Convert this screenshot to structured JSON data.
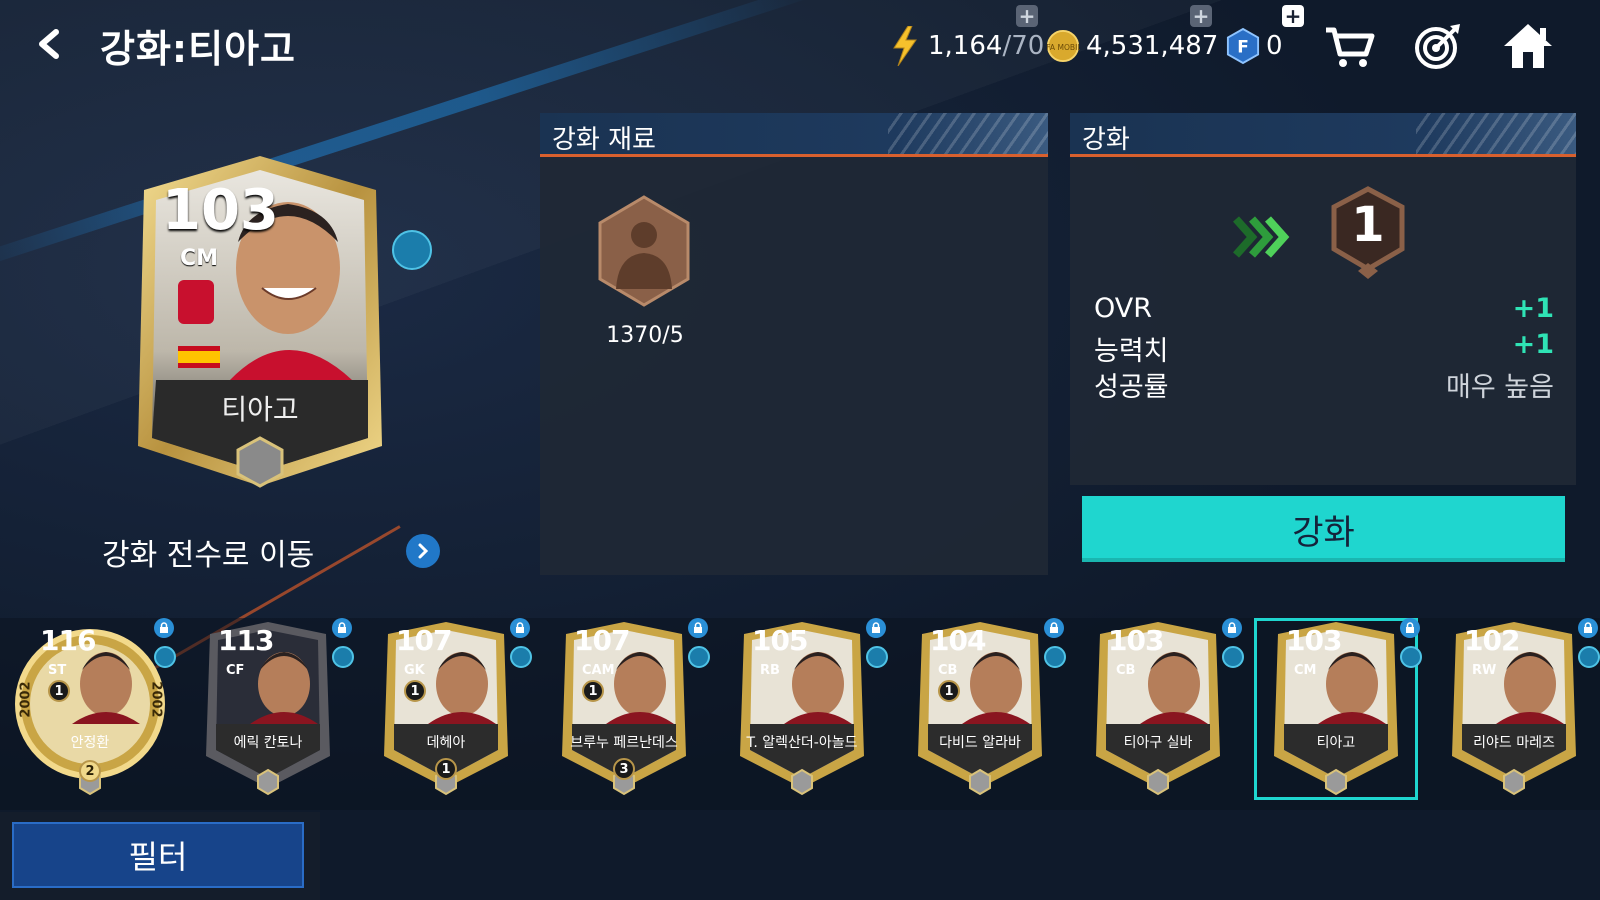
{
  "header": {
    "title": "강화:티아고",
    "energy": "1,164",
    "energy_max": "/70",
    "coins": "4,531,487",
    "fc_points": "0",
    "plus": "+",
    "coin_logo": "FIFA MOBILE",
    "fc_letter": "F"
  },
  "main_card": {
    "ovr": "103",
    "position": "CM",
    "name": "티아고",
    "club_color": "#c8102e",
    "nation": "spain-flag"
  },
  "move_label": "강화 전수로 이동",
  "material_panel": {
    "title": "강화 재료",
    "count": "1370/5"
  },
  "enhance_panel": {
    "title": "강화",
    "target_level": "1",
    "stats": [
      {
        "label": "OVR",
        "value": "+1"
      },
      {
        "label": "능력치",
        "value": "+1"
      },
      {
        "label": "성공률",
        "value": "매우 높음"
      }
    ]
  },
  "enhance_button": "강화",
  "filter_button": "필터",
  "players": [
    {
      "ovr": "116",
      "pos": "ST",
      "name": "안정환",
      "level": "1",
      "rank": "2",
      "year": "2002",
      "type": "icon"
    },
    {
      "ovr": "113",
      "pos": "CF",
      "name": "에릭 칸토나",
      "level": "",
      "type": "legend"
    },
    {
      "ovr": "107",
      "pos": "GK",
      "name": "데헤아",
      "level": "1",
      "bottom": "1",
      "type": "gold"
    },
    {
      "ovr": "107",
      "pos": "CAM",
      "name": "브루누 페르난데스",
      "level": "1",
      "bottom": "3",
      "type": "gold"
    },
    {
      "ovr": "105",
      "pos": "RB",
      "name": "T. 알렉산더-아놀드",
      "level": "",
      "type": "gold"
    },
    {
      "ovr": "104",
      "pos": "CB",
      "name": "다비드 알라바",
      "level": "1",
      "type": "gold"
    },
    {
      "ovr": "103",
      "pos": "CB",
      "name": "티아구 실바",
      "level": "",
      "type": "gold"
    },
    {
      "ovr": "103",
      "pos": "CM",
      "name": "티아고",
      "level": "",
      "type": "gold",
      "selected": true
    },
    {
      "ovr": "102",
      "pos": "RW",
      "name": "리야드 마레즈",
      "level": "",
      "type": "gold"
    }
  ]
}
